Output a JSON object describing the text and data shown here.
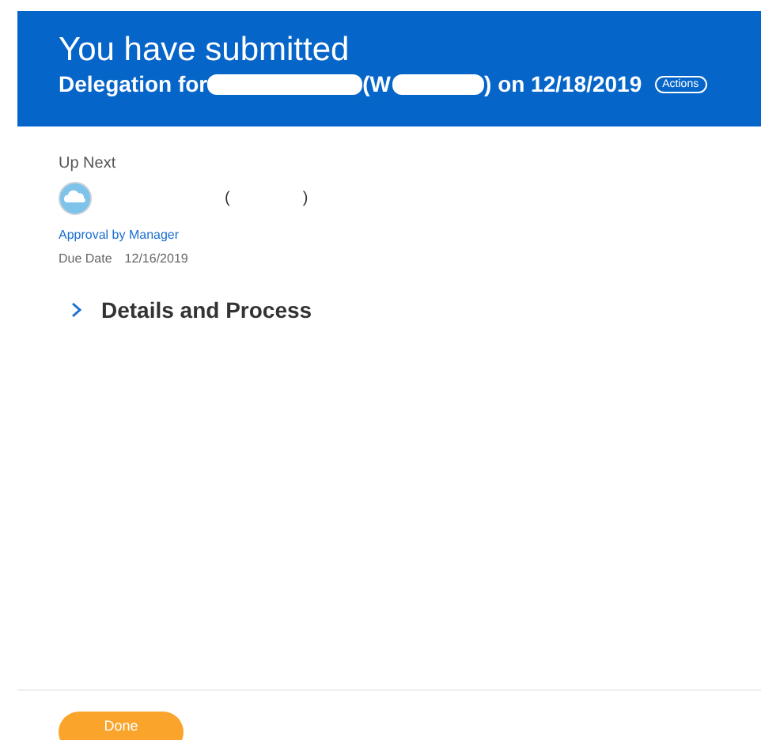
{
  "header": {
    "title": "You have submitted",
    "subtitle_parts": [
      {
        "kind": "text",
        "text": "Delegation for"
      },
      {
        "kind": "redacted"
      },
      {
        "kind": "text",
        "text": "(W"
      },
      {
        "kind": "redacted"
      },
      {
        "kind": "text",
        "text": ") on 12/18/2019"
      }
    ],
    "actions": "Actions"
  },
  "up_next": {
    "heading": "Up Next",
    "name_parts": [
      "(",
      ")"
    ],
    "step": "Approval by Manager",
    "due_label": "Due Date",
    "due_date": "12/16/2019"
  },
  "details": {
    "label": "Details and Process",
    "expanded": false
  },
  "footer": {
    "button": "Done"
  }
}
